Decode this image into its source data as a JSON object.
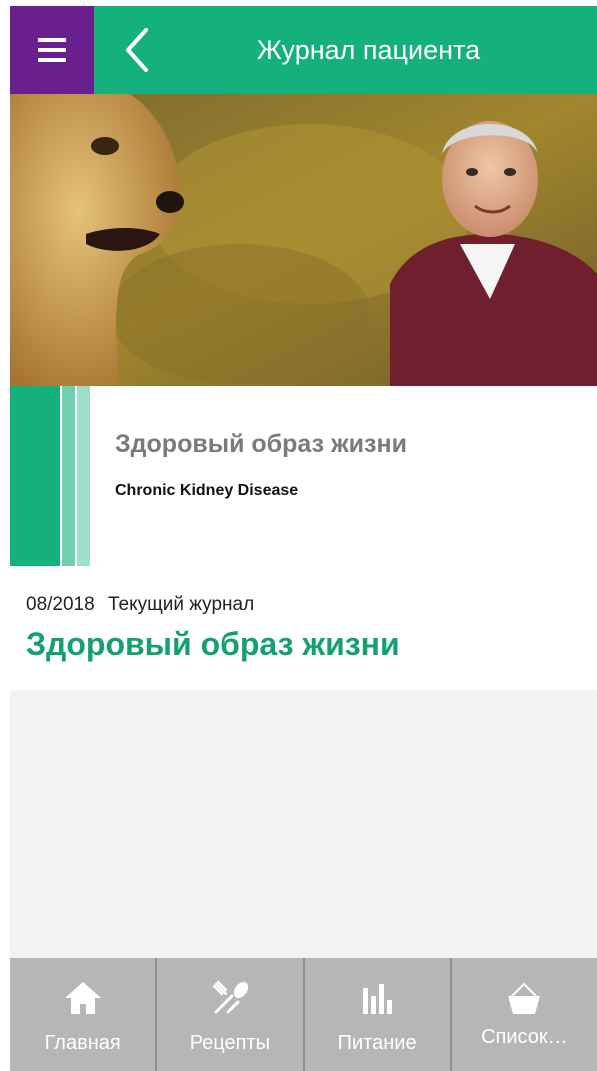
{
  "header": {
    "title": "Журнал пациента",
    "menu_icon": "hamburger-menu-icon",
    "back_icon": "chevron-left-icon",
    "color": "#14b07e",
    "menu_color": "#6a1f8e"
  },
  "hero": {
    "description": "photo-dog-and-man"
  },
  "program_card": {
    "title": "Здоровый образ жизни",
    "subtitle": "Chronic Kidney Disease"
  },
  "journal": {
    "date": "08/2018",
    "label": "Текущий журнал",
    "title": "Здоровый образ жизни"
  },
  "bottom_nav": {
    "items": [
      {
        "label": "Главная",
        "icon": "home-icon"
      },
      {
        "label": "Рецепты",
        "icon": "fork-spoon-icon"
      },
      {
        "label": "Питание",
        "icon": "bar-chart-icon"
      },
      {
        "label": "Список…",
        "icon": "basket-icon"
      }
    ]
  }
}
